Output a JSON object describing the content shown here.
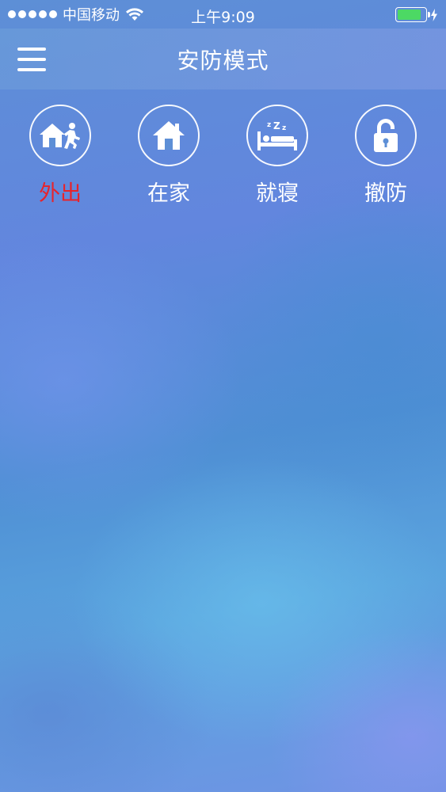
{
  "status_bar": {
    "carrier": "中国移动",
    "time": "上午9:09",
    "signal_bars": 5,
    "battery_level": 0.85,
    "battery_color": "#4cd964",
    "charging": true
  },
  "nav": {
    "title": "安防模式",
    "menu_icon": "hamburger-menu-icon"
  },
  "modes": [
    {
      "label": "外出",
      "icon": "away-house-running-icon",
      "active": true
    },
    {
      "label": "在家",
      "icon": "home-icon",
      "active": false
    },
    {
      "label": "就寝",
      "icon": "sleep-bed-icon",
      "active": false
    },
    {
      "label": "撤防",
      "icon": "unlock-icon",
      "active": false
    }
  ],
  "colors": {
    "active_label": "#e8232a",
    "inactive_label": "#ffffff"
  }
}
